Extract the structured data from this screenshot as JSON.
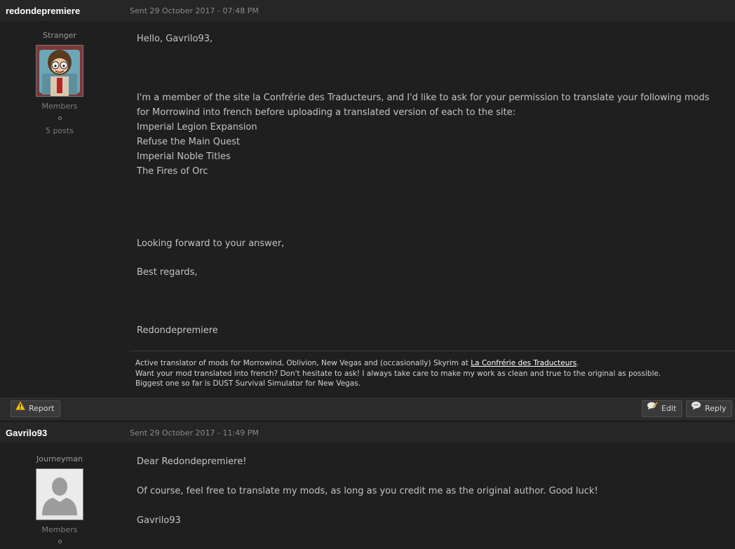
{
  "posts": [
    {
      "username": "redondepremiere",
      "sent": "Sent 29 October 2017 - 07:48 PM",
      "rank": "Stranger",
      "group": "Members",
      "post_count": "5 posts",
      "paragraphs": [
        "Hello, Gavrilo93,",
        "I'm a member of the site la Confrérie des Traducteurs, and I'd like to ask for your permission to translate your following mods for Morrowind into french before uploading a translated version of each to the site:\nImperial Legion Expansion\nRefuse the Main Quest\nImperial Noble Titles\nThe Fires of Orc",
        "Looking forward to your answer,",
        "Best regards,",
        "Redondepremiere"
      ],
      "signature": {
        "line1_prefix": "Active translator of mods for Morrowind, Oblivion, New Vegas and (occasionally) Skyrim at ",
        "line1_link": "La Confrérie des Traducteurs",
        "line1_suffix": ".",
        "line2": "Want your mod translated into french? Don't hesitate to ask! I always take care to make my work as clean and true to the original as possible.",
        "line3": "Biggest one so far is DUST Survival Simulator for New Vegas."
      },
      "actions": {
        "report": "Report",
        "edit": "Edit",
        "reply": "Reply"
      }
    },
    {
      "username": "Gavrilo93",
      "sent": "Sent 29 October 2017 - 11:49 PM",
      "rank": "Journeyman",
      "group": "Members",
      "paragraphs": [
        "Dear Redondepremiere!",
        "Of course, feel free to translate my mods, as long as you credit me as the original author. Good luck!",
        "Gavrilo93"
      ]
    }
  ]
}
